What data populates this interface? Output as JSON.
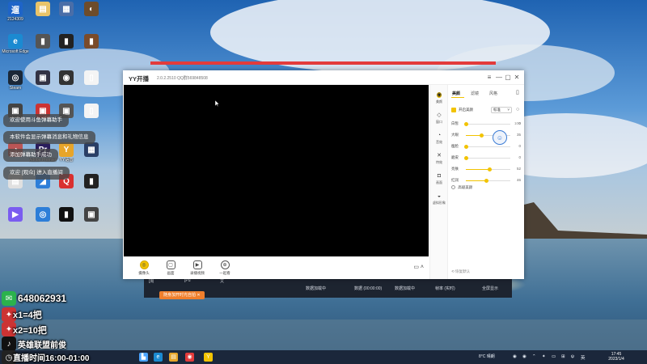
{
  "desktop": {
    "icons": [
      {
        "label": "2124309",
        "glyph": "遛",
        "color": "#1e64c8"
      },
      {
        "label": "",
        "glyph": "▤",
        "color": "#e9c46a"
      },
      {
        "label": "",
        "glyph": "▦",
        "color": "#4a6ea8"
      },
      {
        "label": "",
        "glyph": "◐",
        "color": "#6d4c2b"
      },
      {
        "label": "Microsoft Edge",
        "glyph": "e",
        "color": "#1b8ad1"
      },
      {
        "label": "",
        "glyph": "▮",
        "color": "#555"
      },
      {
        "label": "",
        "glyph": "▮",
        "color": "#222"
      },
      {
        "label": "",
        "glyph": "▮",
        "color": "#7a4b2a"
      },
      {
        "label": "Steam",
        "glyph": "◎",
        "color": "#1b2838"
      },
      {
        "label": "",
        "glyph": "▣",
        "color": "#334"
      },
      {
        "label": "",
        "glyph": "◉",
        "color": "#333"
      },
      {
        "label": "",
        "glyph": "▯",
        "color": "#f4f4f4"
      },
      {
        "label": "",
        "glyph": "▣",
        "color": "#444"
      },
      {
        "label": "",
        "glyph": "▣",
        "color": "#c33"
      },
      {
        "label": "",
        "glyph": "▣",
        "color": "#555"
      },
      {
        "label": "",
        "glyph": "▯",
        "color": "#f4f4f4"
      },
      {
        "label": "",
        "glyph": "◔",
        "color": "#b55"
      },
      {
        "label": "Adobe Premiere",
        "glyph": "Pr",
        "color": "#2a1d5c"
      },
      {
        "label": "YY语音",
        "glyph": "Y",
        "color": "#e7a52a"
      },
      {
        "label": "",
        "glyph": "▦",
        "color": "#2a3f66"
      },
      {
        "label": "",
        "glyph": "▤",
        "color": "#e0e0e0"
      },
      {
        "label": "",
        "glyph": "◢",
        "color": "#2d7ed8"
      },
      {
        "label": "",
        "glyph": "Q",
        "color": "#d93030"
      },
      {
        "label": "",
        "glyph": "▮",
        "color": "#222"
      },
      {
        "label": "",
        "glyph": "▶",
        "color": "#7a5cf0"
      },
      {
        "label": "",
        "glyph": "◎",
        "color": "#2d7ed8"
      },
      {
        "label": "",
        "glyph": "▮",
        "color": "#111"
      },
      {
        "label": "",
        "glyph": "▣",
        "color": "#444"
      }
    ]
  },
  "overlay": {
    "messages": [
      "欢迎使用斗鱼弹幕助手",
      "本软件会显示弹幕消息和礼物信息",
      "添加弹幕助手成功",
      "欢迎 [观众] 进入直播间"
    ],
    "qq": "648062931",
    "line1": "x1=4把",
    "line2": "x2=10把",
    "douyin": "英雄联盟前俊",
    "schedule": "直播时间16:00-01:00"
  },
  "background_window": {
    "texts": [
      "[周",
      "[Pu",
      "文",
      "数据加载中",
      "数据 (00:00:00)",
      "数据加载中",
      "帧率 (实时)",
      "全屏显示"
    ]
  },
  "yy": {
    "logo": "YY开播",
    "version": "2.0.2.2510  QQ群569848508",
    "window_controls": [
      "≡",
      "—",
      "▢",
      "✕"
    ],
    "bottom_tools": [
      {
        "label": "摄像头",
        "icon": "◎"
      },
      {
        "label": "画面",
        "icon": "▢"
      },
      {
        "label": "录播视频",
        "icon": "▶"
      },
      {
        "label": "一起看",
        "icon": "⊕"
      }
    ],
    "camera_control": "▭ ˄",
    "side_nav": [
      {
        "label": "美颜",
        "icon": "◉"
      },
      {
        "label": "窗口",
        "icon": "◇"
      },
      {
        "label": "音效",
        "icon": "◔"
      },
      {
        "label": "特效",
        "icon": "✕"
      },
      {
        "label": "画面",
        "icon": "◘"
      },
      {
        "label": "虚拟形象",
        "icon": "◒"
      }
    ],
    "panel": {
      "tabs": [
        "美颜",
        "滤镜",
        "风格"
      ],
      "layout_icon": "▯",
      "beauty_toggle": "开启美颜",
      "preset": "标准",
      "preset_chevron": "˅",
      "preset_settings": "○",
      "compare_icon": "☺",
      "sliders": [
        {
          "label": "白皙",
          "value": 0,
          "max_label": "100"
        },
        {
          "label": "大眼",
          "value": 35,
          "max_label": ""
        },
        {
          "label": "瘦脸",
          "value": 0,
          "max_label": ""
        },
        {
          "label": "磨皮",
          "value": 0,
          "max_label": ""
        },
        {
          "label": "亮肤",
          "value": 52,
          "max_label": ""
        },
        {
          "label": "红润",
          "value": 46,
          "max_label": ""
        }
      ],
      "range_label_min": "0",
      "range_label_max": "100",
      "advanced": "高级美颜",
      "restore": "恢复默认"
    },
    "orange_pill": "随身加开时光自拍 ✕"
  },
  "taskbar": {
    "icons": [
      {
        "glyph": "▙",
        "color": "#4aa3ff"
      },
      {
        "glyph": "e",
        "color": "#1b8ad1"
      },
      {
        "glyph": "▤",
        "color": "#e7a52a"
      },
      {
        "glyph": "◉",
        "color": "#e33b3b"
      },
      {
        "glyph": "Y",
        "color": "#f2c300"
      }
    ],
    "weather": "8°C 晴朗",
    "tray": [
      "◉",
      "◉",
      "⌃",
      "✦",
      "▭",
      "⊞",
      "ψ",
      "英"
    ],
    "time": "17:45",
    "date": "2023/1/4"
  }
}
